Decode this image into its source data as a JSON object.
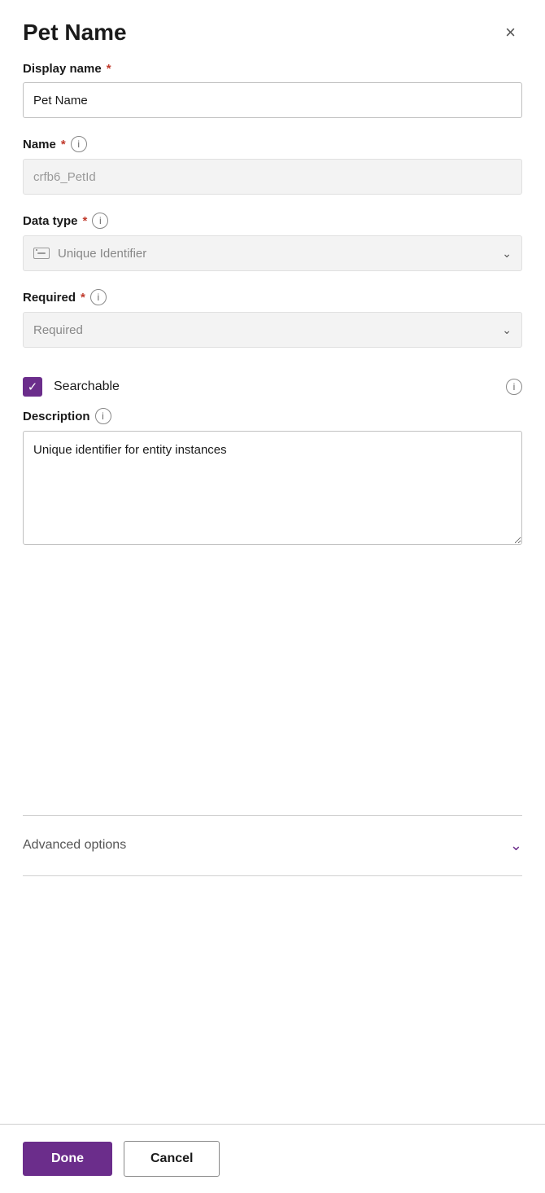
{
  "panel": {
    "title": "Pet Name",
    "close_label": "×"
  },
  "display_name": {
    "label": "Display name",
    "required": true,
    "value": "Pet Name",
    "placeholder": "Pet Name"
  },
  "name_field": {
    "label": "Name",
    "required": true,
    "value": "crfb6_PetId",
    "readonly": true
  },
  "data_type": {
    "label": "Data type",
    "required": true,
    "value": "Unique Identifier",
    "placeholder": "Unique Identifier"
  },
  "required_field": {
    "label": "Required",
    "required": true,
    "value": "Required",
    "placeholder": "Required"
  },
  "searchable": {
    "label": "Searchable",
    "checked": true
  },
  "description": {
    "label": "Description",
    "value": "Unique identifier for entity instances",
    "placeholder": ""
  },
  "advanced_options": {
    "label": "Advanced options"
  },
  "footer": {
    "done_label": "Done",
    "cancel_label": "Cancel"
  }
}
